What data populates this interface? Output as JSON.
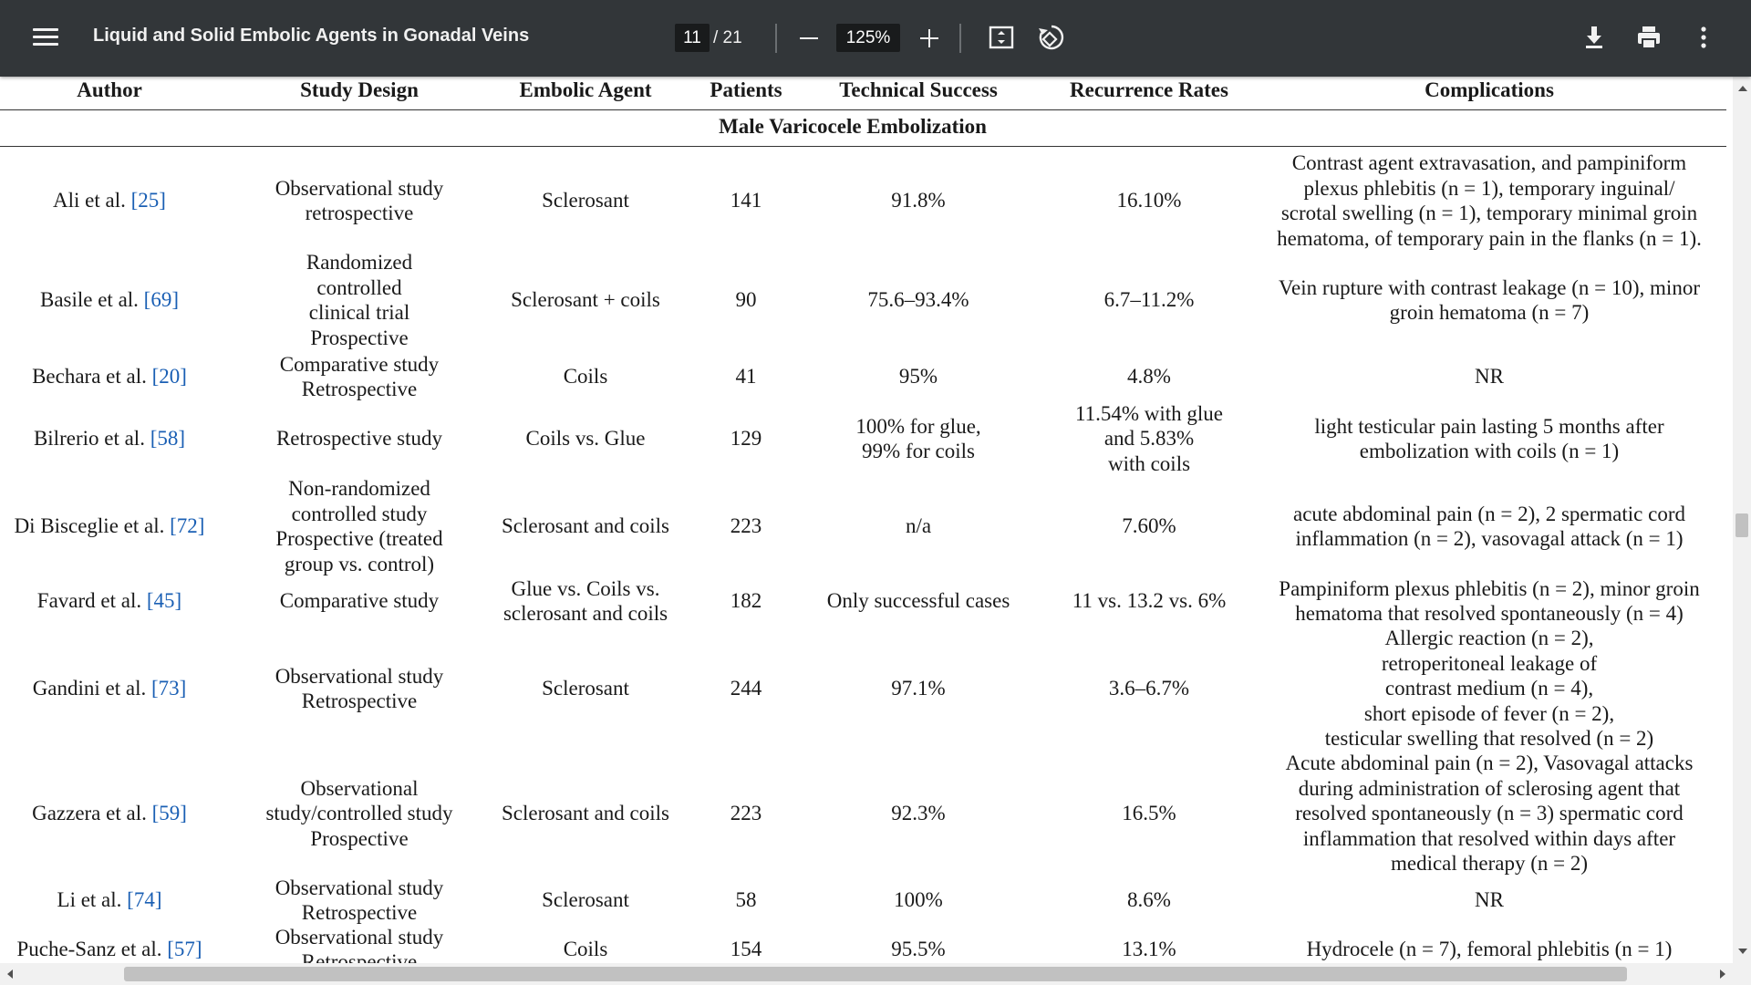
{
  "toolbar": {
    "title": "Liquid and Solid Embolic Agents in Gonadal Veins",
    "page_current": "11",
    "page_total": "/ 21",
    "zoom": "125%",
    "icons": [
      "menu-icon",
      "zoom-out-icon",
      "zoom-in-icon",
      "fit-page-icon",
      "rotate-icon",
      "download-icon",
      "print-icon",
      "more-options-icon"
    ]
  },
  "table": {
    "headers": [
      "Author",
      "Study Design",
      "Embolic Agent",
      "Patients",
      "Technical Success",
      "Recurrence Rates",
      "Complications"
    ],
    "group_label": "Male Varicocele Embolization",
    "rows": [
      {
        "author": "Ali et al. ",
        "ref": "[25]",
        "design": [
          "Observational study",
          "retrospective"
        ],
        "agent": [
          "Sclerosant"
        ],
        "patients": "141",
        "success": [
          "91.8%"
        ],
        "recurrence": [
          "16.10%"
        ],
        "complications": [
          "Contrast agent extravasation, and pampiniform",
          "plexus phlebitis (n = 1), temporary inguinal/",
          "scrotal swelling (n = 1), temporary minimal groin",
          "hematoma, of temporary pain in the flanks (n = 1)."
        ]
      },
      {
        "author": "Basile et al. ",
        "ref": "[69]",
        "design": [
          "Randomized",
          "controlled",
          "clinical trial",
          "Prospective"
        ],
        "agent": [
          "Sclerosant + coils"
        ],
        "patients": "90",
        "success": [
          "75.6–93.4%"
        ],
        "recurrence": [
          "6.7–11.2%"
        ],
        "complications": [
          "Vein rupture with contrast leakage (n = 10), minor",
          "groin hematoma (n = 7)"
        ]
      },
      {
        "author": "Bechara et al. ",
        "ref": "[20]",
        "design": [
          "Comparative study",
          "Retrospective"
        ],
        "agent": [
          "Coils"
        ],
        "patients": "41",
        "success": [
          "95%"
        ],
        "recurrence": [
          "4.8%"
        ],
        "complications": [
          "NR"
        ]
      },
      {
        "author": "Bilrerio et al. ",
        "ref": "[58]",
        "design": [
          "Retrospective study"
        ],
        "agent": [
          "Coils vs. Glue"
        ],
        "patients": "129",
        "success": [
          "100% for glue,",
          "99% for coils"
        ],
        "recurrence": [
          "11.54% with glue",
          "and 5.83%",
          "with coils"
        ],
        "complications": [
          "light testicular pain lasting 5 months after",
          "embolization with coils (n = 1)"
        ]
      },
      {
        "author": "Di Bisceglie et al. ",
        "ref": "[72]",
        "design": [
          "Non-randomized",
          "controlled study",
          "Prospective (treated",
          "group vs. control)"
        ],
        "agent": [
          "Sclerosant and coils"
        ],
        "patients": "223",
        "success": [
          "n/a"
        ],
        "recurrence": [
          "7.60%"
        ],
        "complications": [
          "acute abdominal pain (n = 2), 2 spermatic cord",
          "inflammation (n = 2), vasovagal attack (n = 1)"
        ]
      },
      {
        "author": "Favard et al. ",
        "ref": "[45]",
        "design": [
          "Comparative study"
        ],
        "agent": [
          "Glue vs. Coils vs.",
          "sclerosant and coils"
        ],
        "patients": "182",
        "success": [
          "Only successful cases"
        ],
        "recurrence": [
          "11 vs. 13.2 vs. 6%"
        ],
        "complications": [
          "Pampiniform plexus phlebitis (n = 2), minor groin",
          "hematoma that resolved spontaneously (n = 4)"
        ]
      },
      {
        "author": "Gandini et al. ",
        "ref": "[73]",
        "design": [
          "Observational study",
          "Retrospective"
        ],
        "agent": [
          "Sclerosant"
        ],
        "patients": "244",
        "success": [
          "97.1%"
        ],
        "recurrence": [
          "3.6–6.7%"
        ],
        "complications": [
          "Allergic reaction (n = 2),",
          "retroperitoneal leakage of",
          "contrast medium (n = 4),",
          "short episode of fever (n = 2),",
          "testicular swelling that resolved (n = 2)"
        ]
      },
      {
        "author": "Gazzera et al. ",
        "ref": "[59]",
        "design": [
          "Observational",
          "study/controlled study",
          "Prospective"
        ],
        "agent": [
          "Sclerosant and coils"
        ],
        "patients": "223",
        "success": [
          "92.3%"
        ],
        "recurrence": [
          "16.5%"
        ],
        "complications": [
          "Acute abdominal pain (n = 2), Vasovagal attacks",
          "during administration of sclerosing agent that",
          "resolved spontaneously (n = 3) spermatic cord",
          "inflammation that resolved within days after",
          "medical therapy (n = 2)"
        ]
      },
      {
        "author": "Li et al. ",
        "ref": "[74]",
        "design": [
          "Observational study",
          "Retrospective"
        ],
        "agent": [
          "Sclerosant"
        ],
        "patients": "58",
        "success": [
          "100%"
        ],
        "recurrence": [
          "8.6%"
        ],
        "complications": [
          "NR"
        ]
      },
      {
        "author": "Puche-Sanz et al. ",
        "ref": "[57]",
        "design": [
          "Observational study",
          "Retrospective"
        ],
        "agent": [
          "Coils"
        ],
        "patients": "154",
        "success": [
          "95.5%"
        ],
        "recurrence": [
          "13.1%"
        ],
        "complications": [
          "Hydrocele (n = 7), femoral phlebitis (n = 1)"
        ]
      }
    ]
  }
}
